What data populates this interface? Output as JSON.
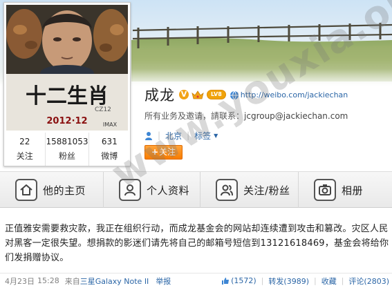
{
  "profile": {
    "name": "成龙",
    "level_badge": "LV8",
    "verified_mark": "V",
    "url": "http://weibo.com/jackiechan",
    "contact_prefix": "所有业务及邀请，請联系：",
    "contact_email": "jcgroup@jackiechan.com",
    "location": "北京",
    "tags_label": "标签",
    "follow_label": "关注",
    "follow_plus": "+"
  },
  "poster": {
    "title": "十二生肖",
    "subtitle": "CZ12",
    "date": "2012·12",
    "brand": "IMAX"
  },
  "stats": [
    {
      "value": "22",
      "label": "关注"
    },
    {
      "value": "15881053",
      "label": "粉丝"
    },
    {
      "value": "631",
      "label": "微博"
    }
  ],
  "tabs": [
    {
      "label": "他的主页",
      "icon": "home-icon"
    },
    {
      "label": "个人资料",
      "icon": "profile-icon"
    },
    {
      "label": "关注/粉丝",
      "icon": "follow-fans-icon"
    },
    {
      "label": "相册",
      "icon": "camera-icon"
    }
  ],
  "post": {
    "text": "正值雅安需要救灾款，我正在组织行动，而成龙基金会的网站却连续遭到攻击和篡改。灾区人民对黑客一定很失望。想捐款的影迷们请先将自己的邮箱号短信到13121618469，基金会将给你们发捐赠协议。",
    "date": "4月23日",
    "time": "15:28",
    "source_prefix": "来自",
    "source_device": "三星Galaxy Note II",
    "report": "举报",
    "likes": "(1572)",
    "repost": "转发(3989)",
    "favorite": "收藏",
    "comments": "评论(2803)"
  },
  "watermark": "www.youxia.org",
  "colors": {
    "link": "#2a65a6",
    "follow_button": "#f77c00",
    "vip_badge": "#f2a317"
  }
}
